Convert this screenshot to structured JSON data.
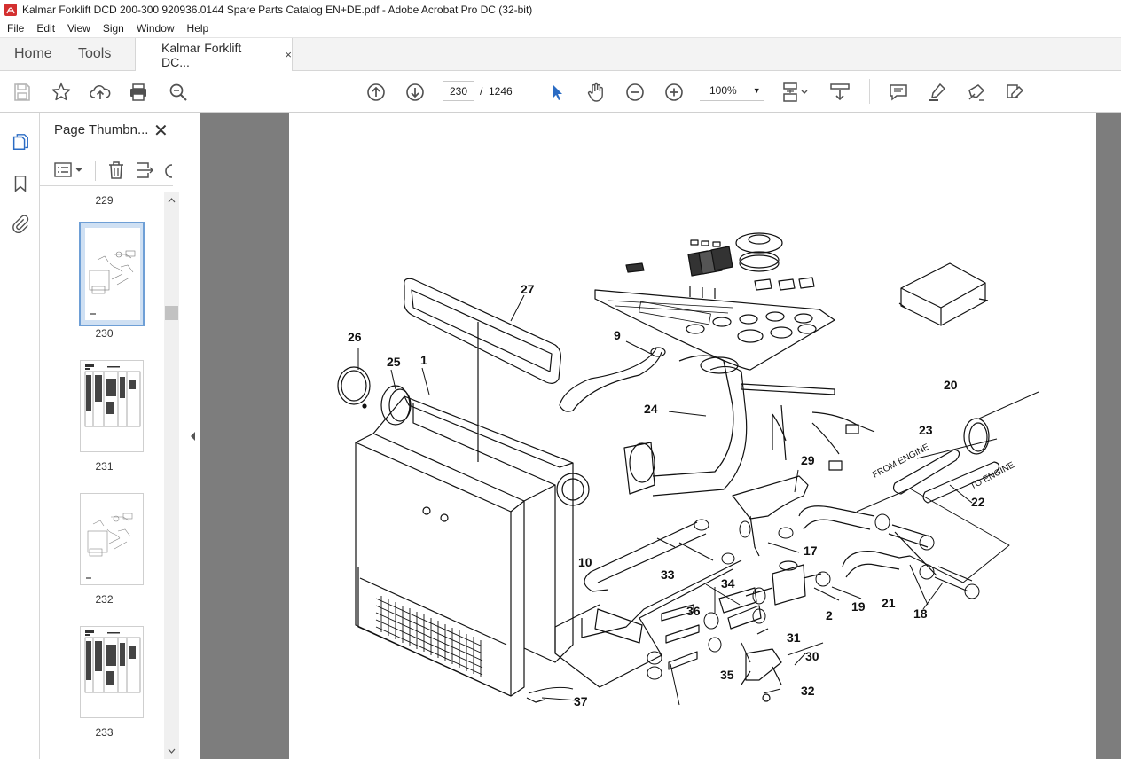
{
  "window": {
    "title": "Kalmar Forklift DCD 200-300 920936.0144 Spare Parts Catalog EN+DE.pdf - Adobe Acrobat Pro DC (32-bit)"
  },
  "menu": [
    "File",
    "Edit",
    "View",
    "Sign",
    "Window",
    "Help"
  ],
  "tabs": {
    "home": "Home",
    "tools": "Tools",
    "document": "Kalmar Forklift DC...",
    "close": "×"
  },
  "toolbar": {
    "page_current": "230",
    "page_separator": "/",
    "page_total": "1246",
    "zoom": "100%",
    "zoom_caret": "▼",
    "icons": [
      "save-icon",
      "bookmark-star-icon",
      "upload-icon",
      "print-icon",
      "zoom-search-icon",
      "page-up-icon",
      "page-down-icon",
      "select-arrow-icon",
      "hand-icon",
      "zoom-out-icon",
      "zoom-in-icon",
      "page-view-icon",
      "scroll-mode-icon",
      "comment-icon",
      "highlight-icon",
      "sign-icon",
      "edit-icon"
    ],
    "accent": "#2b6cc4"
  },
  "panel": {
    "title": "Page Thumbn...",
    "close": "✕",
    "thumbnails": [
      {
        "page": "229"
      },
      {
        "page": "230",
        "selected": true
      },
      {
        "page": "231"
      },
      {
        "page": "232"
      },
      {
        "page": "233"
      }
    ]
  },
  "drawing": {
    "callouts": [
      "1",
      "2",
      "9",
      "10",
      "17",
      "18",
      "19",
      "20",
      "21",
      "22",
      "23",
      "24",
      "25",
      "26",
      "27",
      "29",
      "30",
      "31",
      "32",
      "33",
      "34",
      "35",
      "36",
      "37"
    ],
    "annotations": {
      "from_engine": "FROM ENGINE",
      "to_engine": "TO ENGINE"
    }
  }
}
